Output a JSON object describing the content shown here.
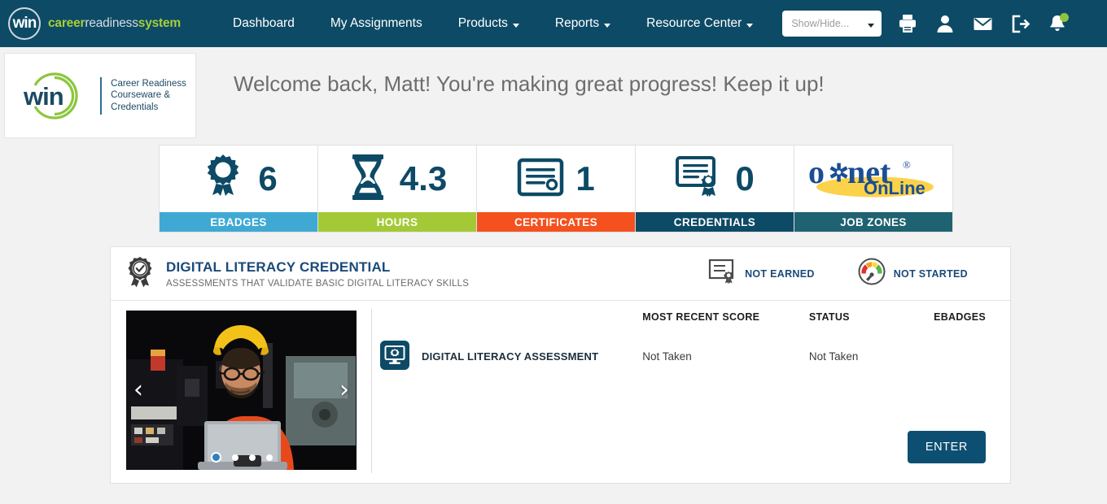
{
  "nav": {
    "brand_mark": "win",
    "brand_career": "career",
    "brand_readiness": "readiness",
    "brand_system": "system",
    "links": [
      {
        "label": "Dashboard",
        "caret": false
      },
      {
        "label": "My Assignments",
        "caret": false
      },
      {
        "label": "Products",
        "caret": true
      },
      {
        "label": "Reports",
        "caret": true
      },
      {
        "label": "Resource Center",
        "caret": true
      }
    ],
    "showhide_placeholder": "Show/Hide...",
    "icons": [
      {
        "name": "print-icon"
      },
      {
        "name": "user-icon"
      },
      {
        "name": "mail-icon"
      },
      {
        "name": "logout-icon"
      },
      {
        "name": "bell-icon",
        "badge": true
      }
    ],
    "bg_color": "#0d4a66",
    "accent_green": "#a6ce39"
  },
  "logo": {
    "word": "win",
    "line1": "Career Readiness",
    "line2": "Courseware &",
    "line3": "Credentials"
  },
  "welcome": {
    "message": "Welcome back, Matt! You're making great progress! Keep it up!"
  },
  "tiles": [
    {
      "icon": "ebadge-rosette-icon",
      "value": "6",
      "label": "EBADGES",
      "color": "#3fa9d4"
    },
    {
      "icon": "hourglass-icon",
      "value": "4.3",
      "label": "HOURS",
      "color": "#a4c936"
    },
    {
      "icon": "certificate-icon",
      "value": "1",
      "label": "CERTIFICATES",
      "color": "#f4511e"
    },
    {
      "icon": "credential-seal-icon",
      "value": "0",
      "label": "CREDENTIALS",
      "color": "#0d4a66"
    },
    {
      "icon": "onet-online-logo",
      "value": "",
      "label": "JOB ZONES",
      "color": "#1f6271"
    }
  ],
  "credential": {
    "icon": "award-check-icon",
    "title": "DIGITAL LITERACY CREDENTIAL",
    "subtitle": "ASSESSMENTS THAT VALIDATE BASIC DIGITAL LITERACY SKILLS",
    "statuses": [
      {
        "icon": "certificate-outline-icon",
        "text": "NOT EARNED"
      },
      {
        "icon": "gauge-icon",
        "text": "NOT STARTED"
      }
    ],
    "carousel": {
      "alt": "Worker in orange coveralls and yellow hard hat holding a laptop in an industrial shop",
      "prev": "‹",
      "next": "›",
      "dot_count": 4,
      "active_dot": 0
    },
    "table": {
      "headers": [
        "",
        "MOST RECENT SCORE",
        "STATUS",
        "EBADGES"
      ],
      "rows": [
        {
          "icon": "assessment-monitor-icon",
          "name": "DIGITAL LITERACY ASSESSMENT",
          "most_recent_score": "Not Taken",
          "status": "Not Taken",
          "ebadges": ""
        }
      ]
    },
    "enter_label": "ENTER"
  }
}
